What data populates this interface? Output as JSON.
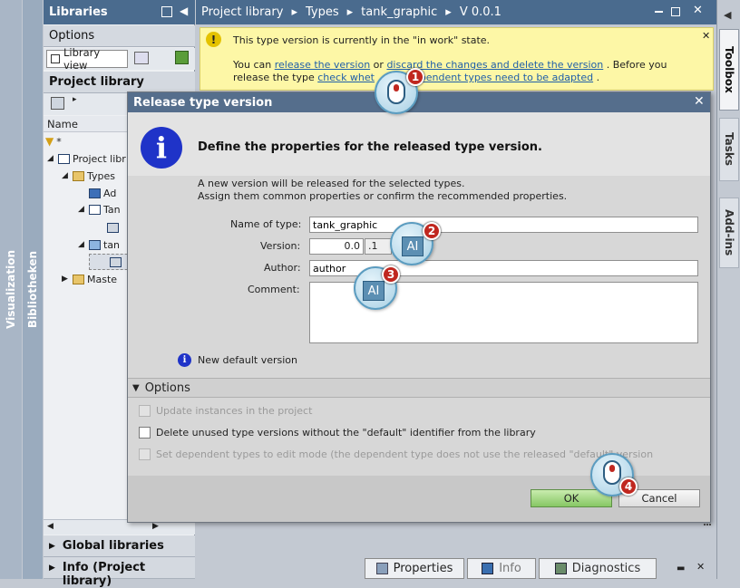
{
  "left_tabs": {
    "visualization": "Visualization",
    "bibliotheken": "Bibliotheken"
  },
  "libraries": {
    "title": "Libraries",
    "options_label": "Options",
    "library_view_label": "Library view",
    "project_library_label": "Project library",
    "name_col": "Name",
    "filter_text": "*",
    "tree": [
      {
        "label": "Project libr"
      },
      {
        "label": "Types"
      },
      {
        "label": "Ad"
      },
      {
        "label": "Tan"
      },
      {
        "label": ""
      },
      {
        "label": "tan"
      },
      {
        "label": ""
      },
      {
        "label": "Maste"
      }
    ],
    "global_libraries": "Global libraries",
    "info_project_library": "Info (Project library)"
  },
  "editor": {
    "breadcrumb": [
      "Project library",
      "Types",
      "tank_graphic",
      "V 0.0.1"
    ],
    "warning_line1": "This type version is currently in the \"in work\" state.",
    "warning_you_can": "You can",
    "warning_link1": "release the version",
    "warning_or": "or",
    "warning_link2": "discard the changes and delete the version",
    "warning_before": ". Before you",
    "warning_release_type": "release the type",
    "warning_link3": "check whet",
    "warning_link3b": "dependent types need to be adapted",
    "warning_end": "."
  },
  "right_tabs": {
    "toolbox": "Toolbox",
    "tasks": "Tasks",
    "addins": "Add-ins"
  },
  "bottom_tabs": {
    "properties": "Properties",
    "info": "Info",
    "diagnostics": "Diagnostics"
  },
  "dialog": {
    "title": "Release type version",
    "heading": "Define the properties for the released type version.",
    "desc1": "A new version will be released for the selected types.",
    "desc2": "Assign them common properties or confirm the recommended properties.",
    "name_of_type_label": "Name of type:",
    "name_of_type_value": "tank_graphic",
    "version_label": "Version:",
    "version_major": "0.0",
    "version_minor": ".1",
    "author_label": "Author:",
    "author_value": "author",
    "comment_label": "Comment:",
    "comment_value": "",
    "default_version_note": "New default version",
    "options_title": "Options",
    "opt_update_instances": "Update instances in the project",
    "opt_delete_unused": "Delete unused type versions without the \"default\" identifier from the library",
    "opt_set_dependent": "Set dependent types to edit mode (the dependent type does not use the released \"default\" version",
    "ok_label": "OK",
    "cancel_label": "Cancel"
  },
  "steps": [
    "1",
    "2",
    "3",
    "4"
  ],
  "ai_glyph": "AI",
  "icons": [
    "info-icon",
    "mouse-icon",
    "text-cursor-icon",
    "close-icon",
    "maximize-icon",
    "minimize-icon"
  ],
  "colors": {
    "header_blue": "#4a6b8e",
    "warning_yellow": "#fdf7a6",
    "ok_green": "#9ad27a",
    "step_red": "#c0271f",
    "link_blue": "#1f5fa8"
  }
}
